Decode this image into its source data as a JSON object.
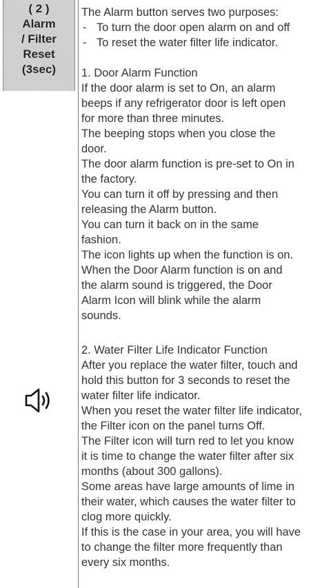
{
  "label": {
    "lines": [
      "( 2 )",
      "Alarm",
      "/ Filter",
      "Reset",
      "(3sec)"
    ]
  },
  "icon": {
    "name": "speaker-icon"
  },
  "intro": "The Alarm button serves two purposes:",
  "bullets": [
    {
      "dash": "-",
      "text": "To turn the door open alarm on and off"
    },
    {
      "dash": "-",
      "text": "To reset the water filter life indicator."
    }
  ],
  "section1": {
    "heading": "1.  Door Alarm Function",
    "lines": [
      "If the door alarm is set to On, an alarm",
      "beeps if any refrigerator door is left open",
      "for more than three minutes.",
      "The beeping stops when you close the",
      "door.",
      "The door alarm function is pre-set to On in",
      "the factory.",
      "You can turn it off by pressing and then",
      "releasing the Alarm button.",
      "You can turn it back on in the same",
      "fashion.",
      "The icon lights up when the function is on.",
      "When the Door Alarm function is on and",
      "the alarm sound is triggered, the Door",
      "Alarm Icon will blink while the alarm",
      "sounds."
    ]
  },
  "section2": {
    "heading": "2.  Water Filter Life Indicator Function",
    "lines": [
      "After you replace the water filter, touch and",
      "hold this button for 3 seconds to reset the",
      "water filter life indicator.",
      "When you reset the water filter life indicator,",
      "the Filter icon on the panel turns Off.",
      "The Filter icon will turn red to let you know",
      "it is time to change the water filter after six",
      "months (about 300 gallons).",
      "Some areas have large amounts of lime in",
      "their water, which causes the water filter to",
      "clog more quickly.",
      "If this is the case in your area, you will have",
      "to change the filter more frequently than",
      "every six months."
    ]
  }
}
